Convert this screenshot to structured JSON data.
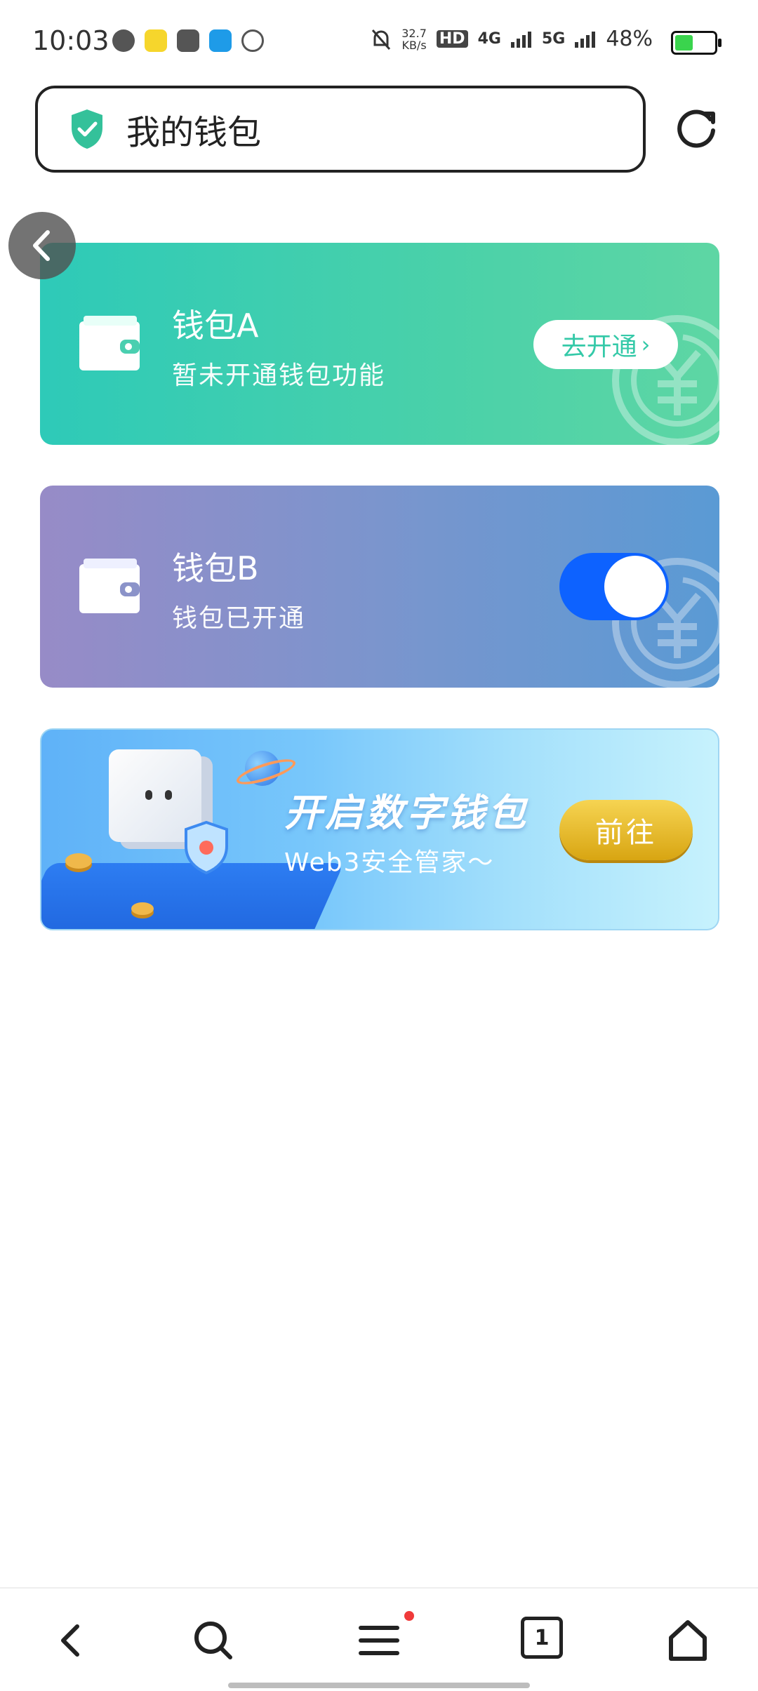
{
  "status_bar": {
    "time": "10:03",
    "net_speed_value": "32.7",
    "net_speed_unit": "KB/s",
    "hd": "HD",
    "net1": "4G",
    "net2": "5G",
    "battery": "48%",
    "battery_level": 0.48,
    "icons": [
      "message-bubble-icon",
      "app-yellow-icon",
      "video-play-icon",
      "app-blue-icon",
      "compass-icon",
      "mute-bell-icon"
    ]
  },
  "header": {
    "title": "我的钱包"
  },
  "wallet_a": {
    "title": "钱包A",
    "subtitle": "暂未开通钱包功能",
    "action_label": "去开通"
  },
  "wallet_b": {
    "title": "钱包B",
    "subtitle": "钱包已开通",
    "toggle_on": true
  },
  "banner": {
    "title": "开启数字钱包",
    "subtitle": "Web3安全管家～",
    "button_label": "前往"
  },
  "bottom_nav": {
    "tab_count": "1",
    "items": [
      "back-icon",
      "search-icon",
      "menu-icon",
      "tabs-icon",
      "home-icon"
    ]
  },
  "colors": {
    "accent_green": "#34c9a8",
    "toggle_blue": "#0d62ff",
    "gold": "#e2b52a"
  }
}
